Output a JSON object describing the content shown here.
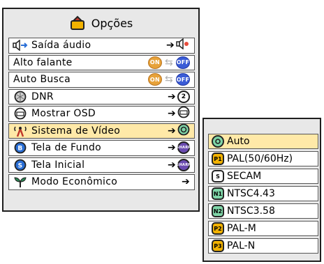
{
  "menu": {
    "title": "Opções",
    "items": [
      {
        "label": "Saída áudio",
        "lead_icon": "speaker-toggle-icon",
        "value_icon": "speaker-icon"
      },
      {
        "label": "Alto falante",
        "on": "ON",
        "off": "OFF"
      },
      {
        "label": "Auto Busca",
        "on": "ON",
        "off": "OFF"
      },
      {
        "label": "DNR",
        "lead_icon": "dnr-icon",
        "value_text": "2"
      },
      {
        "label": "Mostrar OSD",
        "lead_icon": "osd-icon"
      },
      {
        "label": "Sistema de Vídeo",
        "lead_icon": "antenna-icon"
      },
      {
        "label": "Tela de Fundo",
        "lead_icon": "b-icon",
        "value_text": "SHARP"
      },
      {
        "label": "Tela Inicial",
        "lead_icon": "s-icon",
        "value_text": "SHARP"
      },
      {
        "label": "Modo Econômico",
        "lead_icon": "eco-icon"
      }
    ],
    "selected_index": 5
  },
  "submenu": {
    "items": [
      {
        "badge": "",
        "label": "Auto"
      },
      {
        "badge": "P1",
        "label": "PAL(50/60Hz)"
      },
      {
        "badge": "S",
        "label": "SECAM"
      },
      {
        "badge": "N1",
        "label": "NTSC4.43"
      },
      {
        "badge": "N2",
        "label": "NTSC3.58"
      },
      {
        "badge": "P2",
        "label": "PAL-M"
      },
      {
        "badge": "P3",
        "label": "PAL-N"
      }
    ],
    "selected_index": 0
  },
  "colors": {
    "panel_bg": "#e8e8e8",
    "highlight": "#ffe9a8",
    "on_pill": "#e7a23a",
    "off_pill": "#3a5cd7",
    "auto_green": "#7fd6a8"
  }
}
